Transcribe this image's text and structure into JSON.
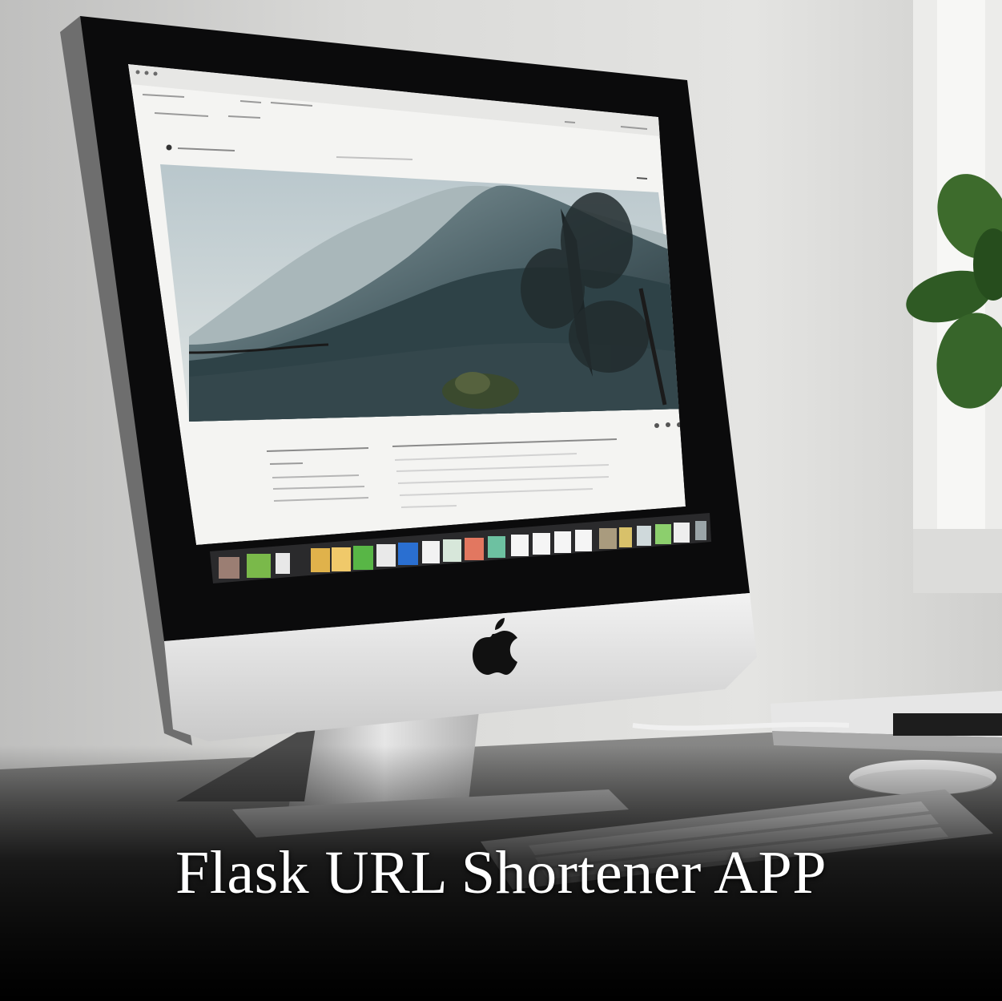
{
  "title": "Flask URL Shortener APP",
  "colors": {
    "wall": "#d8d8d6",
    "bezel": "#0b0b0c",
    "aluminum": "#dcdcdc",
    "browser_bg": "#f4f4f2",
    "hero_sky": "#c5d0d3",
    "hero_water": "#31454b",
    "plant": "#2f5a24",
    "title_text": "#ffffff"
  },
  "icons": [
    "apple-logo-icon",
    "dock-app-icon",
    "browser-nav-icon"
  ]
}
